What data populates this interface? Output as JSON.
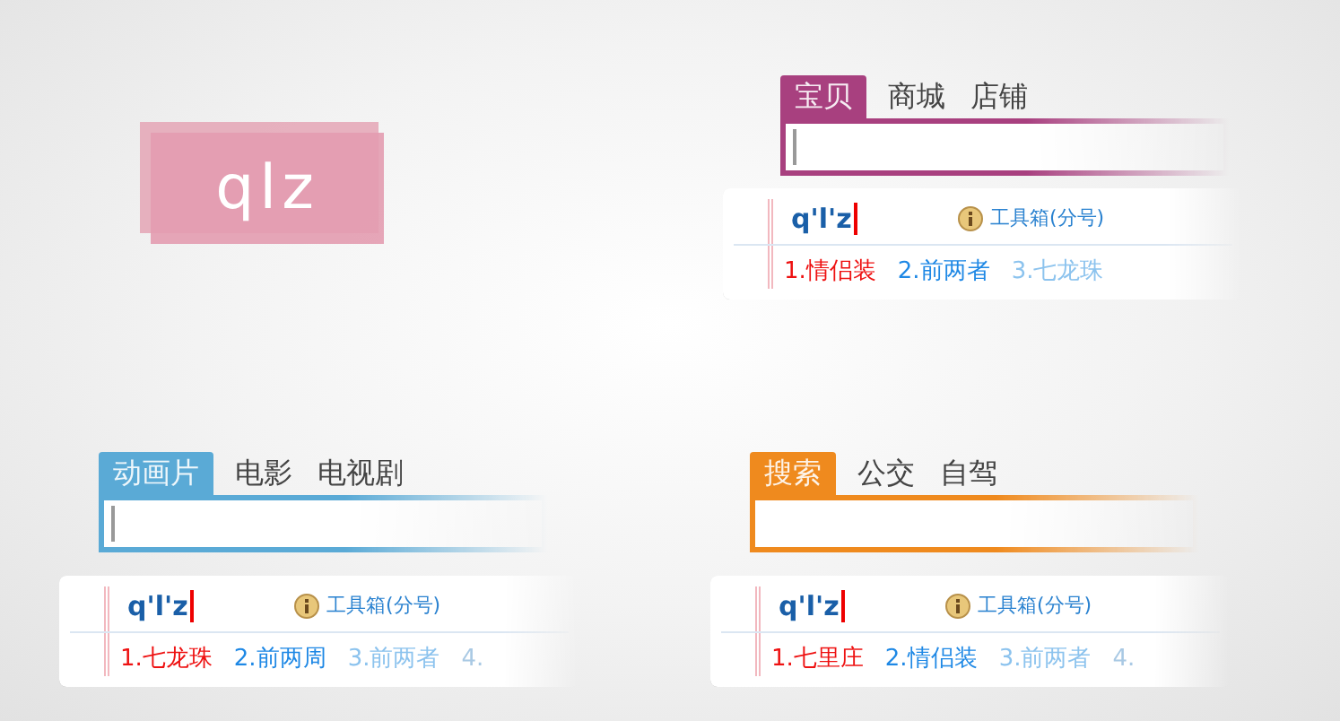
{
  "logo": {
    "text": "qlz"
  },
  "panels": [
    {
      "color": "#a8407f",
      "caret": true,
      "tabs": [
        {
          "label": "宝贝",
          "selected": true
        },
        {
          "label": "商城",
          "selected": false
        },
        {
          "label": "店铺",
          "selected": false
        }
      ],
      "ime": {
        "composition": "q'l'z",
        "toolbox": "工具箱(分号)",
        "candidates": [
          {
            "text": "1.情侣装",
            "selected": true
          },
          {
            "text": "2.前两者",
            "selected": false
          },
          {
            "text": "3.七龙珠",
            "selected": false
          }
        ]
      }
    },
    {
      "color": "#5aaad6",
      "caret": true,
      "tabs": [
        {
          "label": "动画片",
          "selected": true
        },
        {
          "label": "电影",
          "selected": false
        },
        {
          "label": "电视剧",
          "selected": false
        }
      ],
      "ime": {
        "composition": "q'l'z",
        "toolbox": "工具箱(分号)",
        "candidates": [
          {
            "text": "1.七龙珠",
            "selected": true
          },
          {
            "text": "2.前两周",
            "selected": false
          },
          {
            "text": "3.前两者",
            "selected": false
          },
          {
            "text": "4.",
            "selected": false
          }
        ]
      }
    },
    {
      "color": "#ef8a1e",
      "caret": false,
      "tabs": [
        {
          "label": "搜索",
          "selected": true
        },
        {
          "label": "公交",
          "selected": false
        },
        {
          "label": "自驾",
          "selected": false
        }
      ],
      "ime": {
        "composition": "q'l'z",
        "toolbox": "工具箱(分号)",
        "candidates": [
          {
            "text": "1.七里庄",
            "selected": true
          },
          {
            "text": "2.情侣装",
            "selected": false
          },
          {
            "text": "3.前两者",
            "selected": false
          },
          {
            "text": "4.",
            "selected": false
          }
        ]
      }
    }
  ]
}
